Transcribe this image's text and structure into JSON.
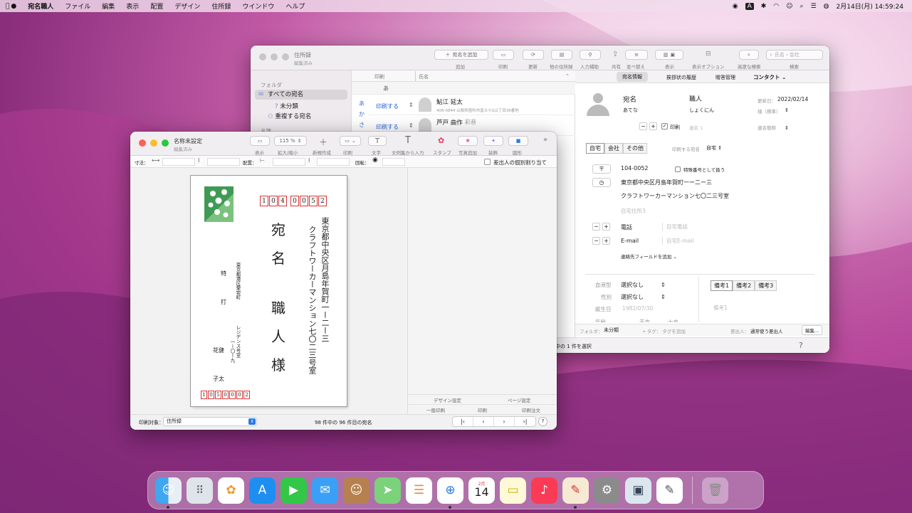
{
  "menubar": {
    "app": "宛名職人",
    "items": [
      "ファイル",
      "編集",
      "表示",
      "配置",
      "デザイン",
      "住所録",
      "ウインドウ",
      "ヘルプ"
    ],
    "input_badge": "A",
    "datetime": "2月14日(月)  14:59:24"
  },
  "back_window": {
    "title": "住所録",
    "subtitle": "編集済み",
    "toolbar": {
      "add_label": "宛名を追加",
      "labels": [
        "追加",
        "印刷",
        "更新",
        "他の住所録",
        "入力補助",
        "共有",
        "並べ替え",
        "表示",
        "表示オプション",
        "高度な検索",
        "検索"
      ],
      "search_placeholder": "氏名・会社"
    },
    "sidebar": {
      "section": "フォルダ",
      "items": [
        "すべての宛名",
        "未分類",
        "重複する宛名"
      ],
      "section2": "名簿"
    },
    "list": {
      "col_print": "印刷",
      "col_name": "氏名",
      "group_header": "あ",
      "index": [
        "あ",
        "か",
        "さ"
      ],
      "rows": [
        {
          "print": "印刷する",
          "name": "鮎江 延太",
          "addr": "406-0844  山梨県笛吹市富士小山2丁目36番地"
        },
        {
          "print": "印刷する",
          "name": "芦戸 曲作",
          "extra": "彩音"
        }
      ]
    },
    "detail": {
      "tabs": [
        "宛名情報",
        "挨拶状の履歴",
        "贈答管理",
        "コンタクト"
      ],
      "name_label": "宛名",
      "kana_label": "あてな",
      "job": "職人",
      "job_kana": "しょくにん",
      "updated_label": "更新日：",
      "updated": "2022/02/14",
      "honorific_label": "様（標準）",
      "print_label": "印刷",
      "name2": "連名 1",
      "name_honor": "連名敬称",
      "addr_tabs": [
        "自宅",
        "会社",
        "その他"
      ],
      "addr_print_label": "印刷する宛名",
      "addr_print_val": "自宅",
      "zip": "104-0052",
      "special": "特殊番号として扱う",
      "addr1": "東京都中央区月島年賀町一ー二ー三",
      "addr2": "クラフトワーカーマンション七〇二三号室",
      "addr3": "自宅住所3",
      "tel_label": "電話",
      "tel_ph": "自宅電話",
      "email_label": "E-mail",
      "email_ph": "自宅E-mail",
      "add_field": "連絡先フィールドを追加",
      "blood_label": "血液型",
      "blood": "選択なし",
      "sex_label": "性別",
      "sex": "選択なし",
      "birth_label": "誕生日",
      "birth": "1982/07/30",
      "age_label": "年齢",
      "eto_label": "干支",
      "zodiac_label": "十支",
      "memo_tabs": [
        "備考1",
        "備考2",
        "備考3"
      ],
      "memo_ph": "備考1",
      "folder_label": "フォルダ：",
      "folder": "未分類",
      "tag_label": "タグ：",
      "tag_ph": "タグを追加",
      "sender_label": "差出人：",
      "sender": "通常使う差出人",
      "edit": "編集..."
    },
    "status": "中の 1 件を選択",
    "help": "?"
  },
  "front_window": {
    "title": "名称未設定",
    "subtitle": "編集済み",
    "toolbar": {
      "zoom": "115 %",
      "labels": [
        "表示",
        "拡大/縮小",
        "新規作成",
        "印刷",
        "文字",
        "文例集から入力",
        "スタンプ",
        "写真追加",
        "装飾",
        "図形"
      ]
    },
    "ruler": {
      "size_label": "寸法：",
      "arrange_label": "配置：",
      "rotate_label": "回転：",
      "check": "差出人の個別割り当て"
    },
    "postcard": {
      "zip_to": [
        "1",
        "0",
        "4",
        "0",
        "0",
        "5",
        "2"
      ],
      "addr_line1": "東京都中央区月島年賀町一ー二ー三",
      "addr_line2": "クラフトワーカーマンション七〇二三号室",
      "name_chars": [
        "宛",
        "名",
        "職",
        "人",
        "様"
      ],
      "sender_addr1": "東京都港区愛宕町",
      "sender_addr2": "一ー〇ー九",
      "sender_bldg": "レジデンス号室",
      "sender_tokuda": "特",
      "sender_kou": "打",
      "sender_n1": "花健",
      "sender_n2": "子太",
      "zip_from": [
        "1",
        "0",
        "5",
        "0",
        "0",
        "0",
        "2"
      ]
    },
    "side": {
      "design": "デザイン設定",
      "page": "ページ設定",
      "tabs": [
        "一般印刷",
        "印刷",
        "印刷注文"
      ]
    },
    "footer": {
      "target_label": "印刷対象：",
      "target": "住所録",
      "count": "98 件中の 96 件目の宛名",
      "help": "?"
    }
  },
  "dock": {
    "calendar_month": "2月",
    "calendar_day": "14"
  }
}
